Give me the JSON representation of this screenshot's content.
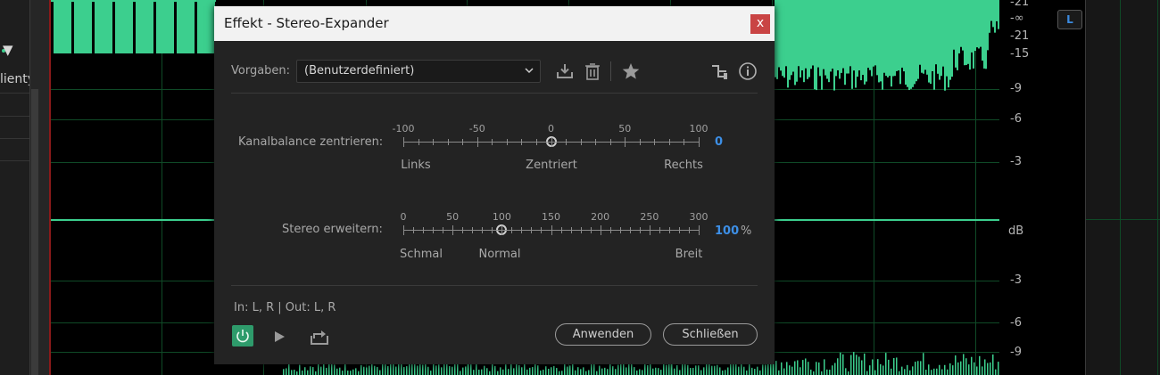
{
  "background": {
    "left_panel": {
      "label": "lienty"
    },
    "db_scale_top": [
      "-21",
      "-∞",
      "-21",
      "-15",
      "-9",
      "-6",
      "-3"
    ],
    "db_unit": "dB",
    "db_scale_bottom": [
      "-3",
      "-6",
      "-9"
    ],
    "channel_button": "L",
    "colors": {
      "waveform": "#3ccf8e",
      "grid": "#0f4a27",
      "playhead": "#8a1a1a"
    }
  },
  "dialog": {
    "title": "Effekt - Stereo-Expander",
    "close_symbol": "x",
    "presets": {
      "label": "Vorgaben:",
      "value": "(Benutzerdefiniert)"
    },
    "toolbar_icons": [
      "download-icon",
      "trash-icon",
      "star-icon",
      "route-icon",
      "info-icon"
    ],
    "balance": {
      "label": "Kanalbalance zentrieren:",
      "ticks": [
        "-100",
        "-50",
        "0",
        "50",
        "100"
      ],
      "min": -100,
      "max": 100,
      "value": 0,
      "value_text": "0",
      "left_text": "Links",
      "center_text": "Zentriert",
      "right_text": "Rechts"
    },
    "stereo": {
      "label": "Stereo erweitern:",
      "ticks": [
        "0",
        "50",
        "100",
        "150",
        "200",
        "250",
        "300"
      ],
      "min": 0,
      "max": 300,
      "value": 100,
      "value_text": "100",
      "unit": "%",
      "left_text": "Schmal",
      "normal_text": "Normal",
      "right_text": "Breit"
    },
    "io": "In: L, R | Out: L, R",
    "buttons": {
      "apply": "Anwenden",
      "close": "Schließen"
    },
    "accent_color": "#3d8fe6",
    "power_color": "#2e9b6b"
  }
}
